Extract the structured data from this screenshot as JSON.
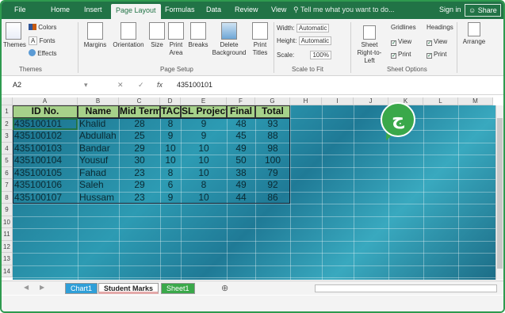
{
  "ribbon_tabs": [
    "File",
    "Home",
    "Insert",
    "Page Layout",
    "Formulas",
    "Data",
    "Review",
    "View"
  ],
  "active_tab": "Page Layout",
  "tell_me": "Tell me what you want to do...",
  "sign_in": "Sign in",
  "share": "Share",
  "ribbon": {
    "themes_group": {
      "label": "Themes",
      "themes": "Themes",
      "colors": "Colors",
      "fonts": "Fonts",
      "effects": "Effects"
    },
    "page_setup_group": {
      "label": "Page Setup",
      "margins": "Margins",
      "orientation": "Orientation",
      "size": "Size",
      "print_area": "Print Area",
      "breaks": "Breaks",
      "background": "Background",
      "delete": "Delete",
      "print_titles": "Print Titles"
    },
    "scale_group": {
      "label": "Scale to Fit",
      "width_label": "Width:",
      "width_value": "Automatic",
      "height_label": "Height:",
      "height_value": "Automatic",
      "scale_label": "Scale:",
      "scale_value": "100%"
    },
    "sheet_options_group": {
      "label": "Sheet Options",
      "rtl": "Sheet Right-to-Left",
      "gridlines": "Gridlines",
      "headings": "Headings",
      "view": "View",
      "print": "Print"
    },
    "arrange": "Arrange"
  },
  "formula_bar": {
    "name_box": "A2",
    "value": "435100101"
  },
  "columns": [
    "A",
    "B",
    "C",
    "D",
    "E",
    "F",
    "G",
    "H",
    "I",
    "J",
    "K",
    "L",
    "M"
  ],
  "rows": [
    "1",
    "2",
    "3",
    "4",
    "5",
    "6",
    "7",
    "8",
    "9",
    "10",
    "11",
    "12",
    "13",
    "14"
  ],
  "table": {
    "headers": [
      "ID No.",
      "Name",
      "Mid Term",
      "TAC",
      "SL Project",
      "Final",
      "Total"
    ],
    "records": [
      [
        "435100101",
        "Khalid",
        "28",
        "8",
        "9",
        "48",
        "93"
      ],
      [
        "435100102",
        "Abdullah",
        "25",
        "9",
        "9",
        "45",
        "88"
      ],
      [
        "435100103",
        "Bandar",
        "29",
        "10",
        "10",
        "49",
        "98"
      ],
      [
        "435100104",
        "Yousuf",
        "30",
        "10",
        "10",
        "50",
        "100"
      ],
      [
        "435100105",
        "Fahad",
        "23",
        "8",
        "10",
        "38",
        "79"
      ],
      [
        "435100106",
        "Saleh",
        "29",
        "6",
        "8",
        "49",
        "92"
      ],
      [
        "435100107",
        "Hussam",
        "23",
        "9",
        "10",
        "44",
        "86"
      ]
    ]
  },
  "sheet_tabs": [
    {
      "label": "Chart1",
      "color": "#2f9fd8"
    },
    {
      "label": "Student Marks",
      "color": "#e4a9a9"
    },
    {
      "label": "Sheet1",
      "color": "#3aa84a"
    }
  ],
  "badge_letter": "ج"
}
